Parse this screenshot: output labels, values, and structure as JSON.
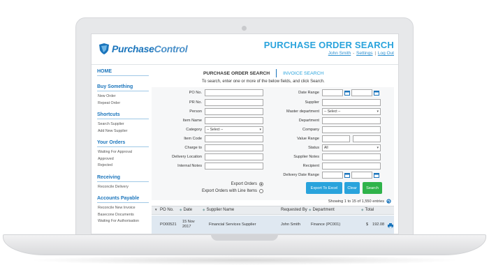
{
  "app": {
    "logo_part1": "Purchase",
    "logo_part2": "Control",
    "page_title": "PURCHASE ORDER SEARCH",
    "user_name": "John Smith",
    "settings_label": "Settings",
    "logout_label": "Log Out"
  },
  "colors": {
    "brand_blue": "#1b75bc",
    "accent_cyan": "#29a3dc",
    "search_green": "#2fb34a"
  },
  "sidebar": {
    "home": "HOME",
    "sections": [
      {
        "title": "Buy Something",
        "items": [
          "New Order",
          "Repeat Order"
        ]
      },
      {
        "title": "Shortcuts",
        "items": [
          "Search Supplier",
          "Add New Supplier"
        ]
      },
      {
        "title": "Your Orders",
        "items": [
          "Waiting For Approval",
          "Approved",
          "Rejected"
        ]
      },
      {
        "title": "Receiving",
        "items": [
          "Reconcile Delivery"
        ]
      },
      {
        "title": "Accounts Payable",
        "items": [
          "Reconcile New Invoice",
          "Basecone Documents",
          "Waiting For Authorisation"
        ]
      }
    ]
  },
  "tabs": {
    "active": "PURCHASE ORDER SEARCH",
    "inactive": "INVOICE SEARCH"
  },
  "instructions": "To search, enter one or more of the below fields, and click Search.",
  "form": {
    "po_no": "PO No.",
    "pr_no": "PR No.",
    "person": "Person",
    "item_name": "Item Name",
    "category": "Category",
    "category_value": "-- Select --",
    "item_code": "Item Code",
    "charge_to": "Charge to",
    "delivery_location": "Delivery Location",
    "internal_notes": "Internal Notes",
    "date_range": "Date Range",
    "supplier": "Supplier",
    "master_department": "Master department",
    "master_department_value": "-- Select --",
    "department": "Department",
    "company": "Company",
    "value_range": "Value Range",
    "status": "Status",
    "status_value": "All",
    "supplier_notes": "Supplier Notes",
    "recipient": "Recipient",
    "delivery_date_range": "Delivery Date Range",
    "export_orders": "Export Orders",
    "export_orders_line_items": "Export Orders with Line Items",
    "export_excel_button": "Export To Excel",
    "clear_button": "Clear",
    "search_button": "Search"
  },
  "table": {
    "showing": "Showing 1 to 15 of 1,550 entries",
    "columns": [
      "PO No.",
      "Date",
      "Supplier Name",
      "Requested By",
      "Department",
      "Total"
    ],
    "rows": [
      {
        "po_no": "PO00521",
        "date_line1": "15 Nov",
        "date_line2": "2017",
        "supplier": "Financial Services Supplier",
        "requested_by": "John Smith",
        "department": "Finance (PC001)",
        "currency": "$",
        "total": "192.08"
      }
    ]
  },
  "icons": {
    "logo": "shield-logo-icon",
    "calendar": "calendar-icon",
    "refresh": "refresh-icon",
    "print": "print-icon"
  }
}
